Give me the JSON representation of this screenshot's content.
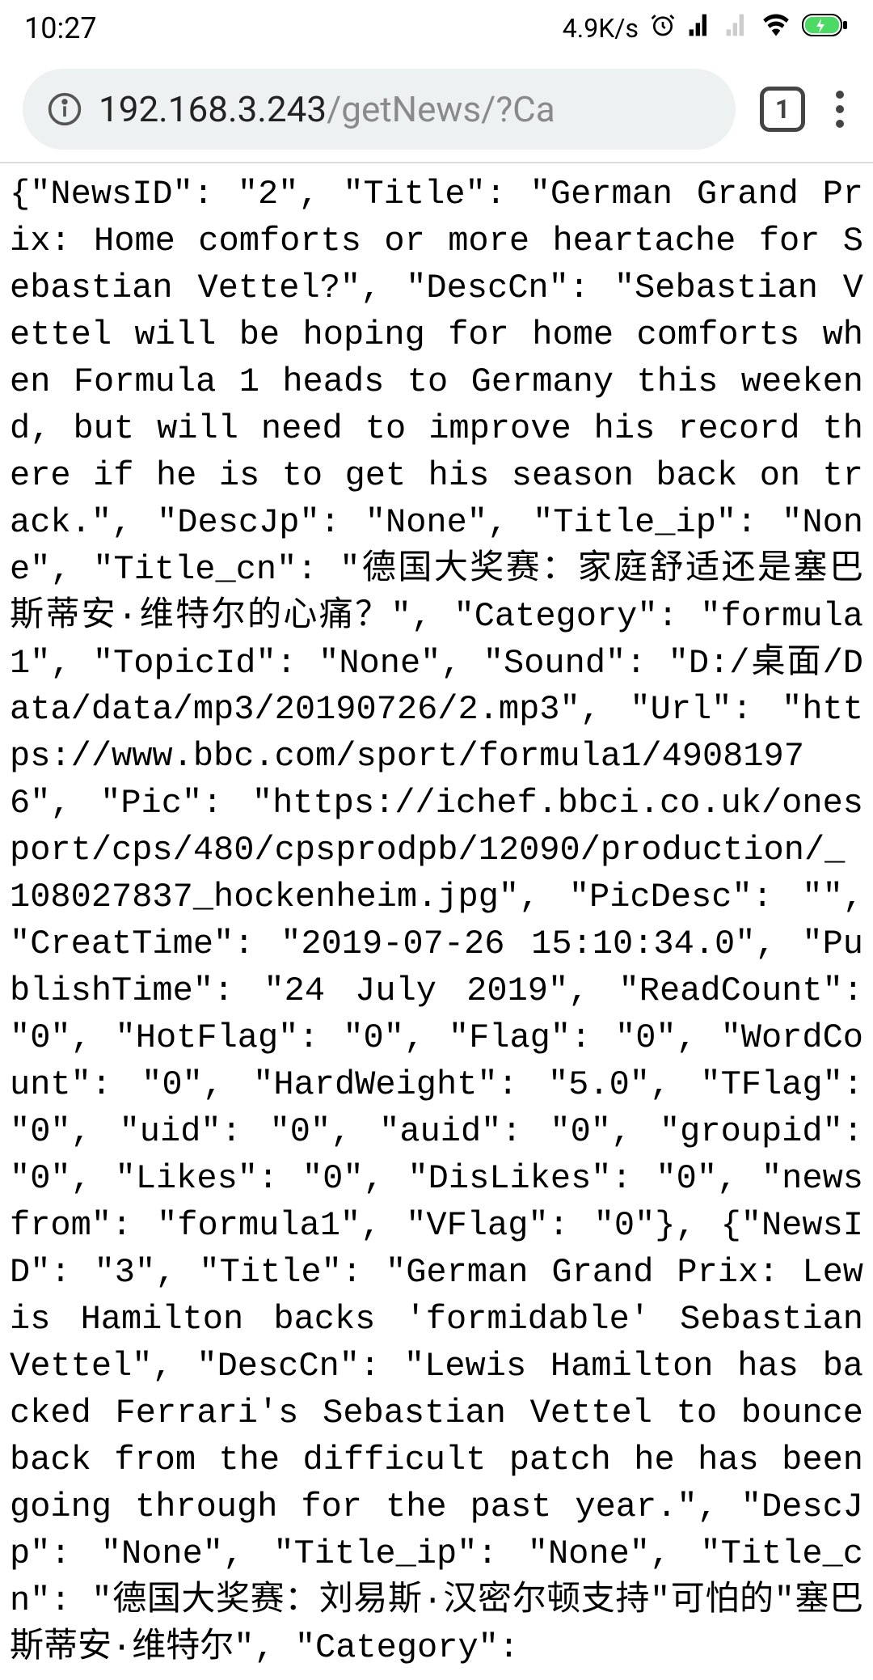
{
  "status_bar": {
    "time": "10:27",
    "speed": "4.9K/s",
    "tab_count": "1"
  },
  "url": {
    "host": "192.168.3.243",
    "path": "/getNews/?Ca"
  },
  "content_text": "{\"NewsID\": \"2\", \"Title\": \"German Grand Prix: Home comforts or more heartache for Sebastian Vettel?\", \"DescCn\": \"Sebastian Vettel will be hoping for home comforts when Formula 1 heads to Germany this weekend, but will need to improve his record there if he is to get his season back on track.\", \"DescJp\": \"None\", \"Title_ip\": \"None\", \"Title_cn\": \"德国大奖赛：家庭舒适还是塞巴斯蒂安·维特尔的心痛？\", \"Category\": \"formula1\", \"TopicId\": \"None\", \"Sound\": \"D:/桌面/Data/data/mp3/20190726/2.mp3\", \"Url\": \"https://www.bbc.com/sport/formula1/49081976\", \"Pic\": \"https://ichef.bbci.co.uk/onesport/cps/480/cpsprodpb/12090/production/_108027837_hockenheim.jpg\", \"PicDesc\": \"\", \"CreatTime\": \"2019-07-26 15:10:34.0\", \"PublishTime\": \"24 July 2019\", \"ReadCount\": \"0\", \"HotFlag\": \"0\", \"Flag\": \"0\", \"WordCount\": \"0\", \"HardWeight\": \"5.0\", \"TFlag\": \"0\", \"uid\": \"0\", \"auid\": \"0\", \"groupid\": \"0\", \"Likes\": \"0\", \"DisLikes\": \"0\", \"newsfrom\": \"formula1\", \"VFlag\": \"0\"}, {\"NewsID\": \"3\", \"Title\": \"German Grand Prix: Lewis Hamilton backs 'formidable' Sebastian Vettel\", \"DescCn\": \"Lewis Hamilton has backed Ferrari's Sebastian Vettel to bounce back from the difficult patch he has been going through for the past year.\", \"DescJp\": \"None\", \"Title_ip\": \"None\", \"Title_cn\": \"德国大奖赛：刘易斯·汉密尔顿支持\"可怕的\"塞巴斯蒂安·维特尔\", \"Category\":"
}
